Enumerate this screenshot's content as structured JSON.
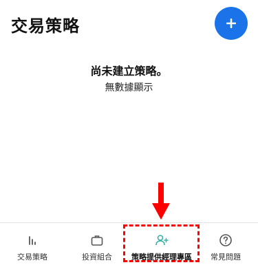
{
  "header": {
    "title": "交易策略",
    "add_button_icon": "plus-icon"
  },
  "empty_state": {
    "title": "尚未建立策略。",
    "subtitle": "無數據顯示"
  },
  "annotation": {
    "arrow_color": "#ff0000",
    "box_color": "#ff0000"
  },
  "colors": {
    "accent": "#1a73e8",
    "active_icon": "#36b3a5",
    "inactive_icon": "#555555"
  },
  "tabbar": {
    "items": [
      {
        "label": "交易策略",
        "icon": "bar-chart-icon"
      },
      {
        "label": "投資組合",
        "icon": "briefcase-icon"
      },
      {
        "label": "策略提供經理專區",
        "icon": "user-plus-icon"
      },
      {
        "label": "常見問題",
        "icon": "help-circle-icon"
      }
    ]
  }
}
